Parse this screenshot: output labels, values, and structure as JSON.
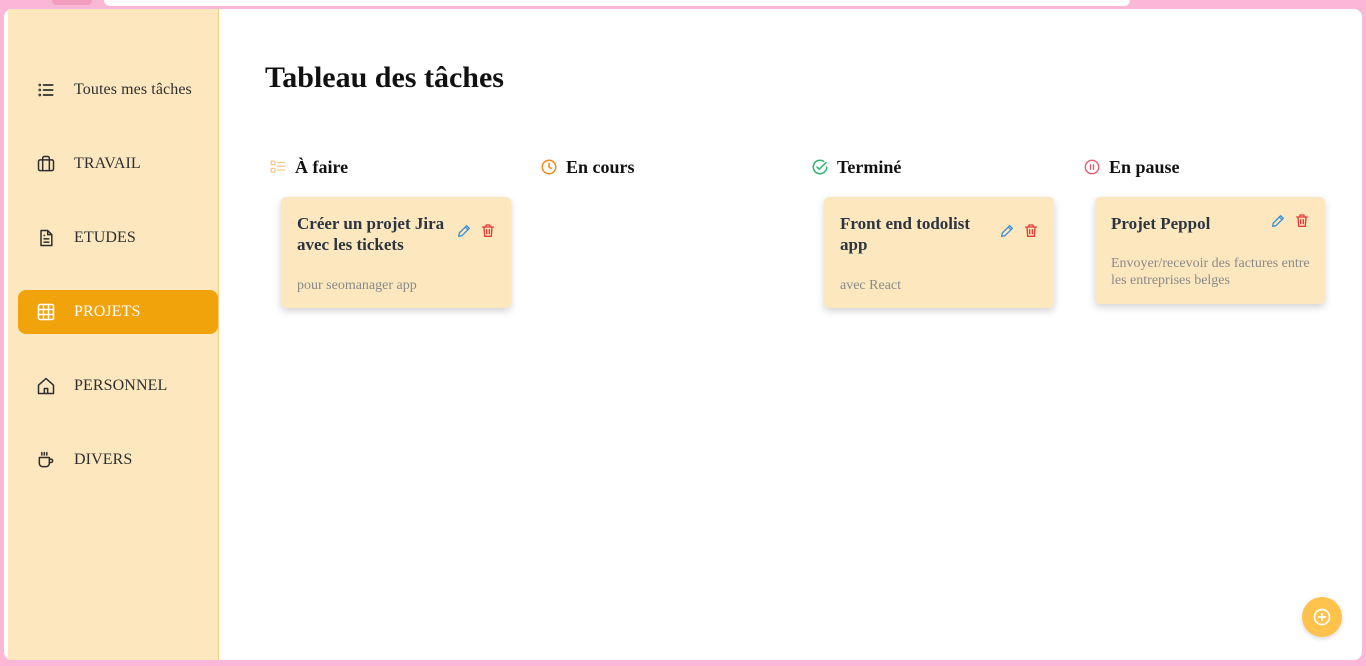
{
  "colors": {
    "sidebar_bg": "#fce7be",
    "active_bg": "#f0a30a",
    "card_bg": "#fce7be",
    "fab_bg": "#ffc24d",
    "todo_icon": "#f5c98a",
    "inprogress_icon": "#f08a1a",
    "done_icon": "#2bb673",
    "paused_icon": "#e8556e",
    "edit_icon": "#3b8fd6",
    "delete_icon": "#e53935"
  },
  "sidebar": {
    "items": [
      {
        "label": "Toutes mes tâches",
        "icon": "list-icon",
        "active": false
      },
      {
        "label": "TRAVAIL",
        "icon": "briefcase-icon",
        "active": false
      },
      {
        "label": "ETUDES",
        "icon": "document-icon",
        "active": false
      },
      {
        "label": "PROJETS",
        "icon": "grid-icon",
        "active": true
      },
      {
        "label": "PERSONNEL",
        "icon": "home-icon",
        "active": false
      },
      {
        "label": "DIVERS",
        "icon": "coffee-icon",
        "active": false
      }
    ]
  },
  "main": {
    "title": "Tableau des tâches",
    "columns": [
      {
        "title": "À faire",
        "icon": "checklist-icon"
      },
      {
        "title": "En cours",
        "icon": "clock-icon"
      },
      {
        "title": "Terminé",
        "icon": "check-circle-icon"
      },
      {
        "title": "En pause",
        "icon": "pause-circle-icon"
      }
    ],
    "cards": [
      {
        "column": 0,
        "title": "Créer un projet Jira avec les tickets",
        "description": "pour seomanager app"
      },
      {
        "column": 2,
        "title": "Front end todolist app",
        "description": "avec React"
      },
      {
        "column": 3,
        "title": "Projet Peppol",
        "description": "Envoyer/recevoir des factures entre les entreprises belges"
      }
    ]
  },
  "fab": {
    "icon": "plus-circle-icon"
  }
}
